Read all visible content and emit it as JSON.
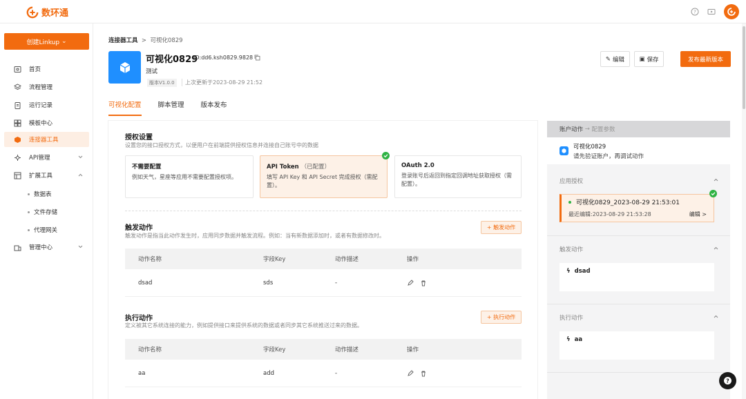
{
  "app": {
    "brand": "数环通",
    "accent": "#f26b0f"
  },
  "sidebar": {
    "create_label": "创建Linkup",
    "items": [
      {
        "label": "首页",
        "icon": "home-icon"
      },
      {
        "label": "流程管理",
        "icon": "layers-icon"
      },
      {
        "label": "运行记录",
        "icon": "clipboard-icon"
      },
      {
        "label": "模板中心",
        "icon": "grid-icon"
      },
      {
        "label": "连接器工具",
        "icon": "cube-icon"
      },
      {
        "label": "API管理",
        "icon": "api-icon"
      },
      {
        "label": "扩展工具",
        "icon": "extension-icon"
      },
      {
        "label": "管理中心",
        "icon": "admin-icon"
      }
    ],
    "sub_items": [
      "数据表",
      "文件存储",
      "代理网关"
    ]
  },
  "breadcrumb": {
    "root": "连接器工具",
    "sep": ">",
    "current": "可视化0829"
  },
  "connector": {
    "title": "可视化0829",
    "id": "ID:dd6.ksh0829.9828",
    "desc": "测试",
    "version": "版本V1.0.0",
    "updated": "上次更新于2023-08-29 21:52"
  },
  "actions": {
    "edit": "编辑",
    "save": "保存",
    "publish": "发布最新版本"
  },
  "tabs": [
    "可视化配置",
    "脚本管理",
    "版本发布"
  ],
  "auth": {
    "title": "授权设置",
    "desc": "设置您的接口授权方式，以便用户在前端提供授权信息并连接自己账号中的数据",
    "options": [
      {
        "title": "不需要配置",
        "note": "",
        "desc": "例如天气，星座等应用不需要配置授权项。"
      },
      {
        "title": "API Token",
        "note": "（已配置）",
        "desc": "填写 API Key 和 API Secret 完成授权（需配置）。"
      },
      {
        "title": "OAuth 2.0",
        "note": "",
        "desc": "登录账号后返回到指定回调地址获取授权（需配置）。"
      }
    ]
  },
  "trigger": {
    "title": "触发动作",
    "desc": "触发动作是指当此动作发生时，应用同步数据并触发流程。例如：当有新数据添加时，或者有数据修改时。",
    "add_label": "+ 触发动作",
    "columns": [
      "动作名称",
      "字段Key",
      "动作描述",
      "操作"
    ],
    "rows": [
      {
        "name": "dsad",
        "key": "sds",
        "desc": "-"
      }
    ]
  },
  "execute": {
    "title": "执行动作",
    "desc": "定义被其它系统连接的能力，例如提供接口来提供系统的数据或者同步其它系统推送过来的数据。",
    "add_label": "+ 执行动作",
    "columns": [
      "动作名称",
      "字段Key",
      "动作描述",
      "操作"
    ],
    "rows": [
      {
        "name": "aa",
        "key": "add",
        "desc": "-"
      }
    ]
  },
  "right_panel": {
    "step1": "账户动作",
    "arrow": "→",
    "step2": "配置参数",
    "notice_title": "可视化0829",
    "notice_text": "请先验证账户，再调试动作",
    "auth_section": "应用授权",
    "auth_name": "可视化0829_2023-08-29 21:53:01",
    "auth_edited": "最近编辑:2023-08-29 21:53:28",
    "auth_edit": "编辑 >",
    "trigger_section": "触发动作",
    "trigger_item": "dsad",
    "execute_section": "执行动作",
    "execute_item": "aa"
  }
}
